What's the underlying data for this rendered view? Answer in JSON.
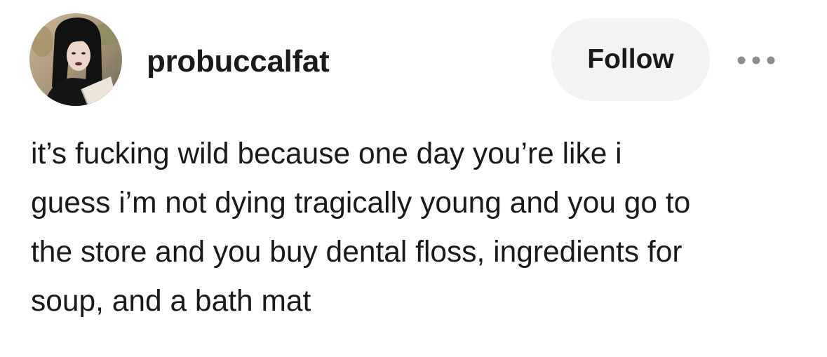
{
  "post": {
    "author": {
      "username": "probuccalfat",
      "avatar_icon": "user-avatar-photo"
    },
    "actions": {
      "follow_label": "Follow",
      "more_icon": "more-options-icon"
    },
    "body_lines": [
      "it’s fucking wild because one day you’re like i",
      "guess i’m not dying tragically young and you go to",
      "the store and you buy dental floss, ingredients for",
      "soup, and a bath mat"
    ]
  },
  "colors": {
    "background": "#ffffff",
    "text": "#1a1a1a",
    "follow_button_bg": "#f2f3f5",
    "more_dots": "#8a8d92"
  }
}
